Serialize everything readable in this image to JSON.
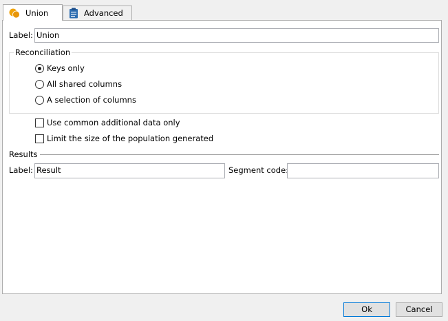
{
  "tabs": [
    {
      "label": "Union",
      "icon": "union-icon",
      "active": true
    },
    {
      "label": "Advanced",
      "icon": "clipboard-icon",
      "active": false
    }
  ],
  "label_field": {
    "label": "Label:",
    "value": "Union"
  },
  "reconciliation": {
    "title": "Reconciliation",
    "options": [
      {
        "label": "Keys only",
        "checked": true
      },
      {
        "label": "All shared columns",
        "checked": false
      },
      {
        "label": "A selection of columns",
        "checked": false
      }
    ]
  },
  "checkboxes": [
    {
      "label": "Use common additional data only",
      "checked": false
    },
    {
      "label": "Limit the size of the population generated",
      "checked": false
    }
  ],
  "results": {
    "title": "Results",
    "label": "Label:",
    "label_value": "Result",
    "segment_label": "Segment code:",
    "segment_value": ""
  },
  "buttons": {
    "ok": "Ok",
    "cancel": "Cancel"
  },
  "colors": {
    "union_icon": "#f0a30a",
    "clipboard_icon": "#2b6cb0",
    "accent": "#0078d7"
  }
}
